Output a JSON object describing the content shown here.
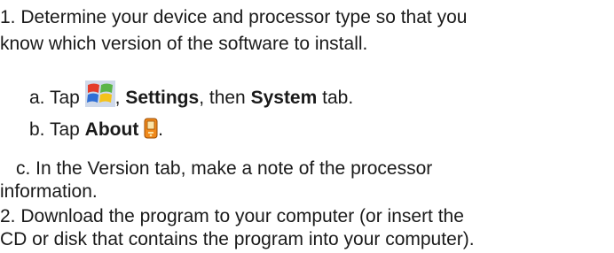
{
  "doc": {
    "step1": "1. Determine your device and processor type so that you",
    "step1_cont": "know which version of the software to install.",
    "step_a": {
      "prefix": "a. Tap ",
      "icon": "windows-start-icon",
      "sep": ", ",
      "settings": "Settings",
      "mid": ", then ",
      "system": "System",
      "suffix": " tab."
    },
    "step_b": {
      "prefix": "b. Tap ",
      "about": "About",
      "icon": "about-device-icon",
      "suffix": "."
    },
    "step_c": "c. In the Version tab, make a note of the processor",
    "step_c_cont": "information.",
    "step2": "2. Download the program to your computer (or insert the",
    "step2_cont": "CD or disk that contains the program into your computer)."
  },
  "colors": {
    "text": "#1a1a1a",
    "windows_red": "#e43b2a",
    "windows_green": "#5ab547",
    "windows_blue": "#2f6fd6",
    "windows_yellow": "#f4c21b",
    "about_orange": "#f08a1c"
  }
}
